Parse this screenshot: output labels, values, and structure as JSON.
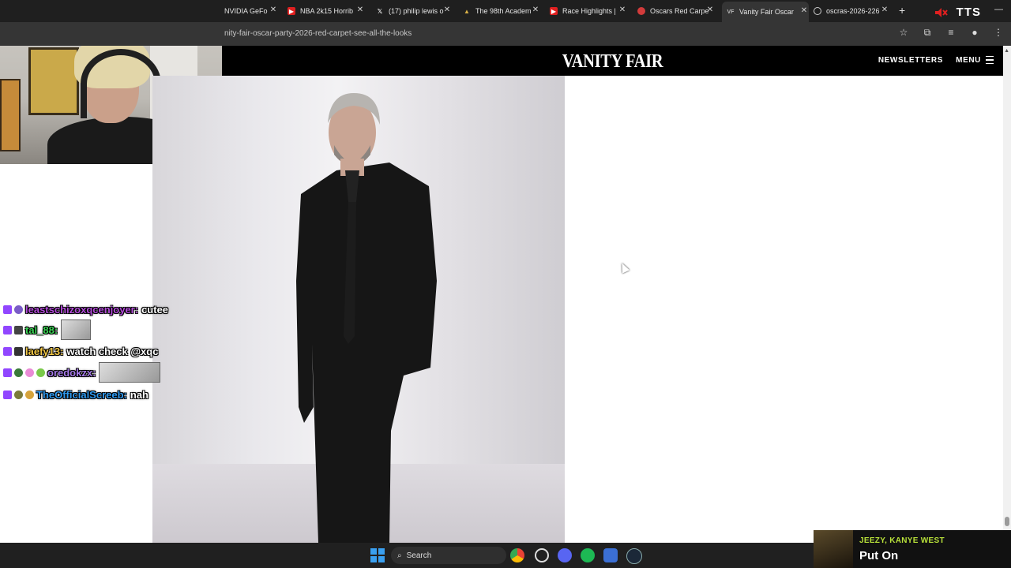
{
  "browser": {
    "tabs": [
      {
        "label": "NVIDIA GeFo",
        "icon": "nvidia-icon"
      },
      {
        "label": "NBA 2k15 Horrib",
        "icon": "youtube-icon"
      },
      {
        "label": "(17) philip lewis o",
        "icon": "x-icon"
      },
      {
        "label": "The 98th Academ",
        "icon": "oscars-icon"
      },
      {
        "label": "Race Highlights |",
        "icon": "youtube-icon"
      },
      {
        "label": "Oscars Red Carpe",
        "icon": "news-icon"
      },
      {
        "label": "Vanity Fair Oscar",
        "icon": "vf-icon",
        "active": true
      },
      {
        "label": "oscras-2026-226",
        "icon": "globe-icon"
      }
    ],
    "new_tab": "+",
    "overlay_text": "TTS",
    "url": "nity-fair-oscar-party-2026-red-carpet-see-all-the-looks"
  },
  "page": {
    "logo": "VANITY FAIR",
    "nav_newsletters": "NEWSLETTERS",
    "nav_menu": "MENU"
  },
  "chat": [
    {
      "user": "leastschizoxqcenjoyer:",
      "text": "cutee",
      "user_color": "#b44bdb"
    },
    {
      "user": "tal_88:",
      "text": "",
      "user_color": "#39d353",
      "emote": true
    },
    {
      "user": "laefy13:",
      "text": "watch check @xqc",
      "user_color": "#f2c744"
    },
    {
      "user": "oredokzx:",
      "text": "",
      "user_color": "#a77bea",
      "emote": true
    },
    {
      "user": "TheOfficialScreeb:",
      "text": "nah",
      "user_color": "#2f9bf2"
    }
  ],
  "taskbar": {
    "search_label": "Search"
  },
  "now_playing": {
    "artist": "JEEZY, KANYE WEST",
    "song": "Put On"
  },
  "colors": {
    "tabbar_bg": "#1f1f1f",
    "address_bg": "#353535",
    "vf_header_bg": "#000000",
    "np_artist": "#b9e23a"
  }
}
